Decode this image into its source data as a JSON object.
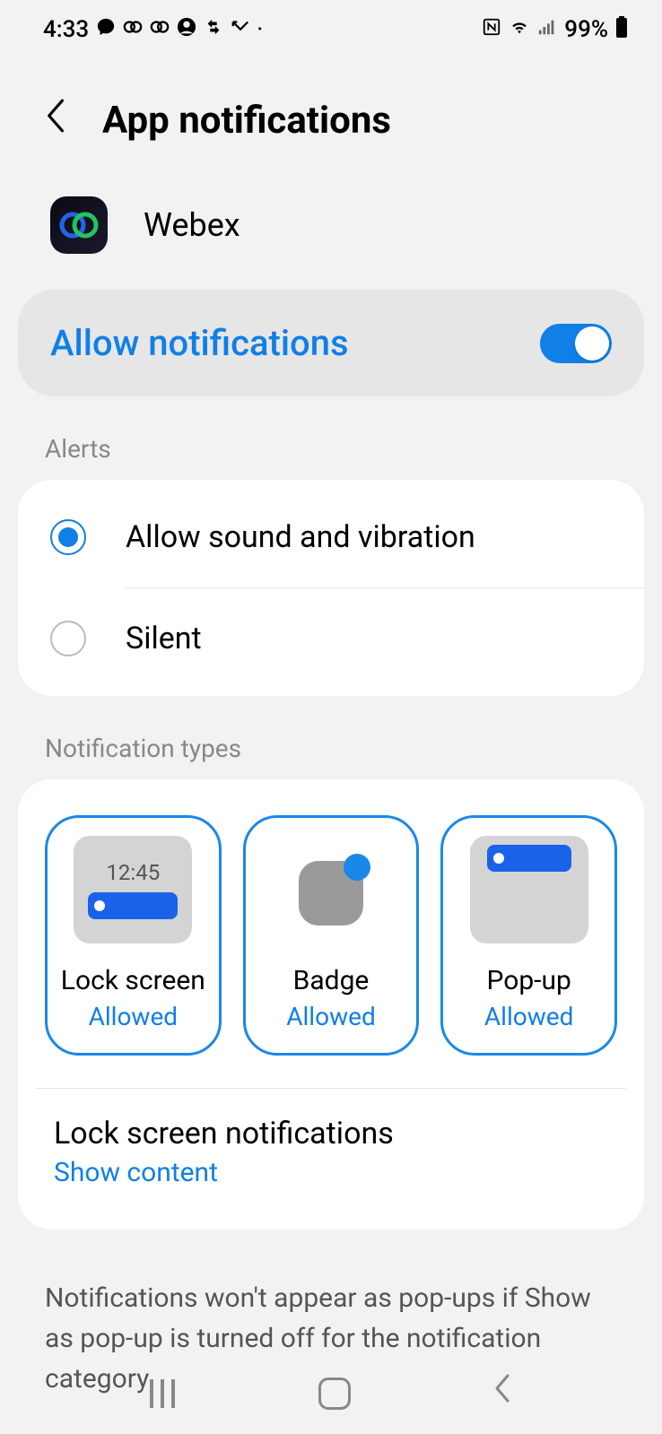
{
  "status": {
    "time": "4:33",
    "battery": "99%"
  },
  "header": {
    "title": "App notifications"
  },
  "app": {
    "name": "Webex"
  },
  "allow": {
    "label": "Allow notifications"
  },
  "sections": {
    "alerts": "Alerts",
    "types": "Notification types"
  },
  "alerts": {
    "options": {
      "0": {
        "label": "Allow sound and vibration"
      },
      "1": {
        "label": "Silent"
      }
    }
  },
  "types": {
    "tiles": {
      "0": {
        "label": "Lock screen",
        "status": "Allowed",
        "time": "12:45"
      },
      "1": {
        "label": "Badge",
        "status": "Allowed"
      },
      "2": {
        "label": "Pop-up",
        "status": "Allowed"
      }
    }
  },
  "lockscreen": {
    "title": "Lock screen notifications",
    "subtitle": "Show content"
  },
  "footer": "Notifications won't appear as pop-ups if Show as pop-up is turned off for the notification category."
}
